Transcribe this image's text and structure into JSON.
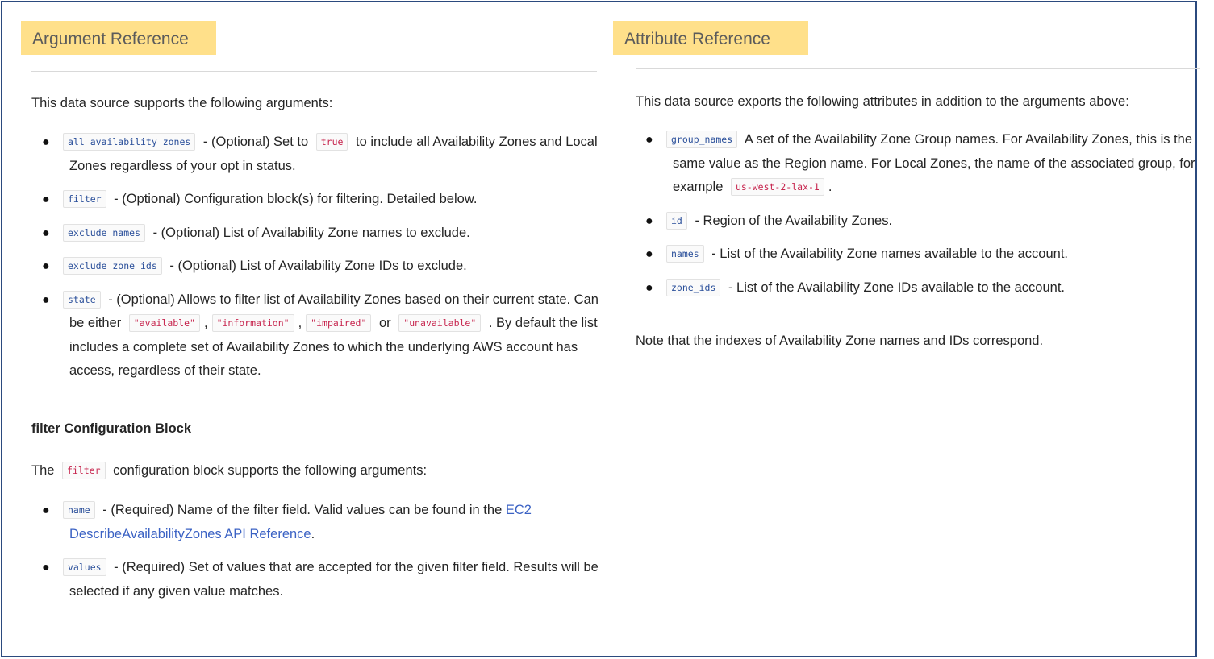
{
  "left": {
    "heading": "Argument Reference",
    "intro": "This data source supports the following arguments:",
    "args": {
      "all_az": {
        "code": "all_availability_zones",
        "pre": "- (Optional) Set to",
        "code2": "true",
        "post": "to include all Availability Zones and Local Zones regardless of your opt in status."
      },
      "filter": {
        "code": "filter",
        "text": "- (Optional) Configuration block(s) for filtering. Detailed below."
      },
      "exclude_names": {
        "code": "exclude_names",
        "text": "- (Optional) List of Availability Zone names to exclude."
      },
      "exclude_zone_ids": {
        "code": "exclude_zone_ids",
        "text": "- (Optional) List of Availability Zone IDs to exclude."
      },
      "state": {
        "code": "state",
        "t1": "- (Optional) Allows to filter list of Availability Zones based on their current state. Can be either",
        "v1": "\"available\"",
        "sep1": ",",
        "v2": "\"information\"",
        "sep2": ",",
        "v3": "\"impaired\"",
        "or": "or",
        "v4": "\"unavailable\"",
        "t2": ". By default the list includes a complete set of Availability Zones to which the underlying AWS account has access, regardless of their state."
      }
    },
    "filter_block": {
      "heading": "filter Configuration Block",
      "intro_pre": "The",
      "intro_code": "filter",
      "intro_post": "configuration block supports the following arguments:",
      "name": {
        "code": "name",
        "text": "- (Required) Name of the filter field. Valid values can be found in the",
        "link": "EC2 DescribeAvailabilityZones API Reference",
        "end": "."
      },
      "values": {
        "code": "values",
        "text": "- (Required) Set of values that are accepted for the given filter field. Results will be selected if any given value matches."
      }
    }
  },
  "right": {
    "heading": "Attribute Reference",
    "intro": "This data source exports the following attributes in addition to the arguments above:",
    "attrs": {
      "group_names": {
        "code": "group_names",
        "text": "A set of the Availability Zone Group names. For Availability Zones, this is the same value as the Region name. For Local Zones, the name of the associated group, for example",
        "code2": "us-west-2-lax-1",
        "end": "."
      },
      "id": {
        "code": "id",
        "text": "- Region of the Availability Zones."
      },
      "names": {
        "code": "names",
        "text": "- List of the Availability Zone names available to the account."
      },
      "zone_ids": {
        "code": "zone_ids",
        "text": "- List of the Availability Zone IDs available to the account."
      }
    },
    "note": "Note that the indexes of Availability Zone names and IDs correspond."
  },
  "colors": {
    "heading_bg": "#ffe08a",
    "frame_border": "#2b4a7e",
    "code_blue": "#2a4f9a",
    "code_red": "#c7254e",
    "link": "#3b62c4"
  }
}
